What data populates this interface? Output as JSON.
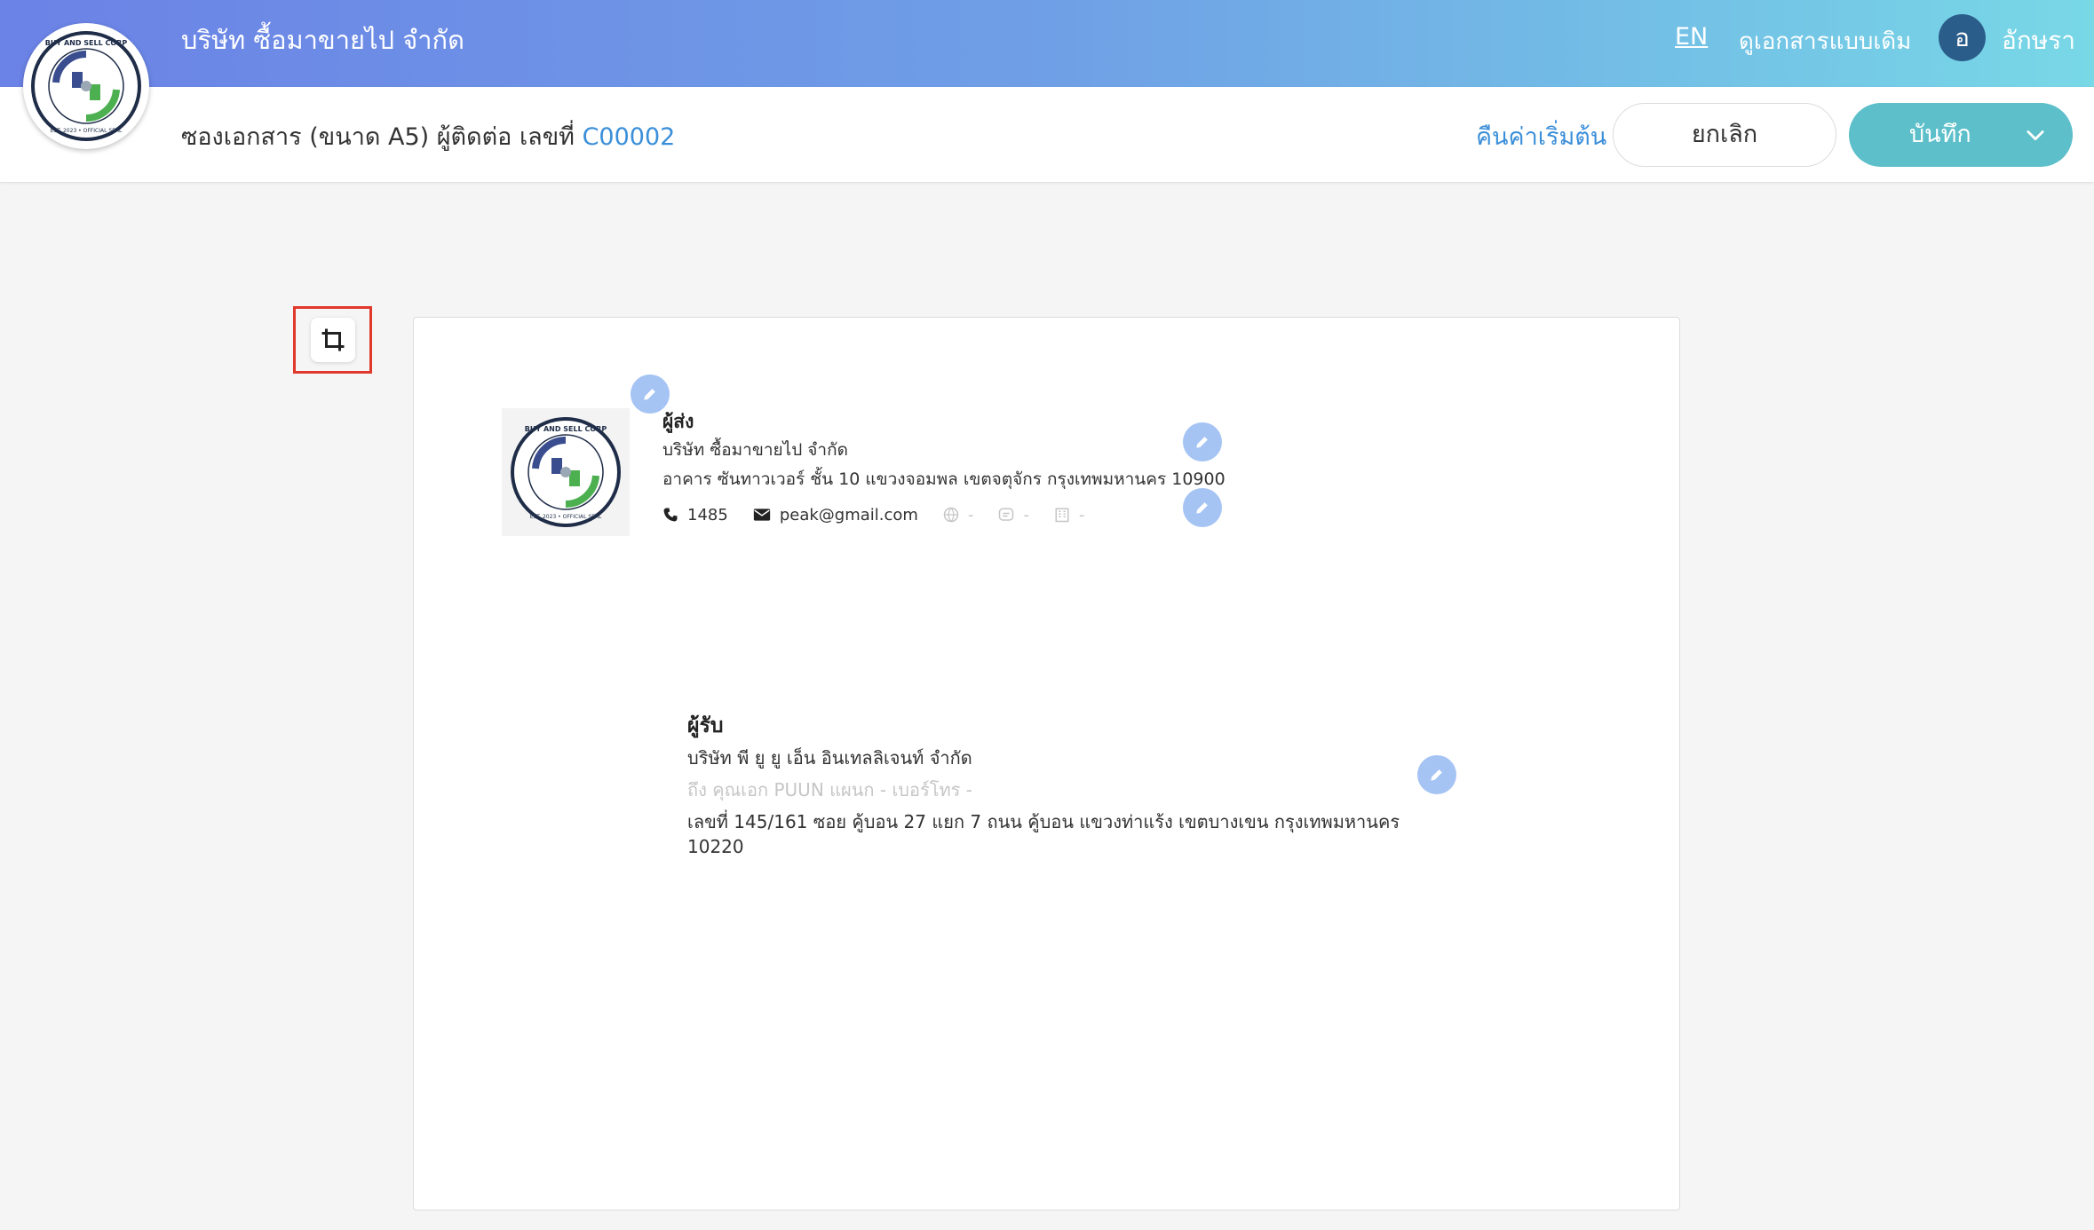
{
  "header": {
    "company_name": "บริษัท ซื้อมาขายไป จำกัด",
    "lang_toggle": "EN",
    "old_doc_view": "ดูเอกสารแบบเดิม",
    "avatar_initial": "อ",
    "user_name": "อักษรา"
  },
  "toolbar": {
    "doc_title_prefix": "ซองเอกสาร (ขนาด A5) ผู้ติดต่อ เลขที่",
    "doc_code": "C00002",
    "reset_label": "คืนค่าเริ่มต้น",
    "cancel_label": "ยกเลิก",
    "save_label": "บันทึก"
  },
  "sender": {
    "heading": "ผู้ส่ง",
    "company": "บริษัท ซื้อมาขายไป จำกัด",
    "address": "อาคาร ซันทาวเวอร์ ชั้น 10 แขวงจอมพล เขตจตุจักร กรุงเทพมหานคร 10900",
    "phone": "1485",
    "email": "peak@gmail.com",
    "website": "-",
    "line": "-",
    "fax": "-"
  },
  "receiver": {
    "heading": "ผู้รับ",
    "company": "บริษัท พี ยู ยู เอ็น อินเทลลิเจนท์ จำกัด",
    "attention": "ถึง คุณเอก PUUN แผนก - เบอร์โทร -",
    "address": "เลขที่ 145/161     ซอย คู้บอน 27 แยก 7 ถนน คู้บอน  แขวงท่าแร้ง เขตบางเขน กรุงเทพมหานคร 10220"
  },
  "icons": {
    "logo": "company-seal-icon",
    "crop": "crop-icon",
    "edit": "pencil-icon",
    "phone": "phone-icon",
    "email": "envelope-icon",
    "website": "globe-icon",
    "line": "chat-icon",
    "fax": "building-icon",
    "dropdown": "chevron-down-icon"
  },
  "colors": {
    "header_gradient_start": "#6b82e6",
    "header_gradient_end": "#78d8e6",
    "link_blue": "#3b8fd9",
    "save_teal": "#5cbfca",
    "edit_button": "#a5c4f4",
    "crop_highlight": "#e0382a",
    "avatar_bg": "#2b5d8a"
  }
}
